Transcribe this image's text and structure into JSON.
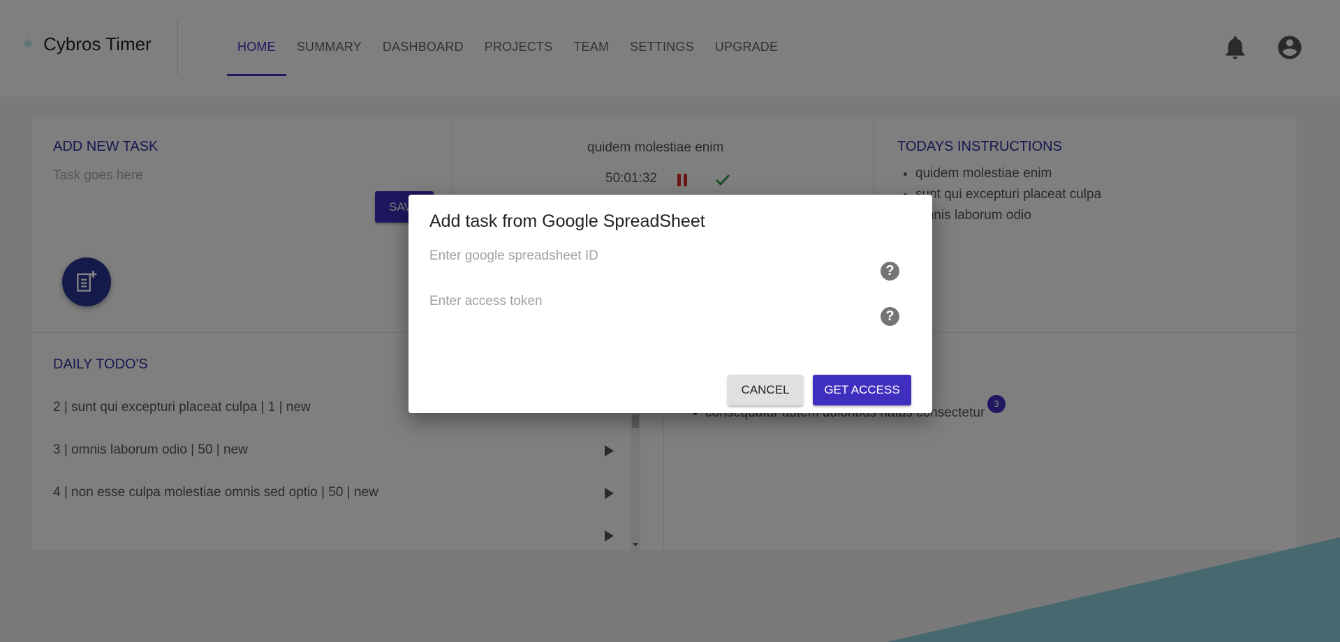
{
  "header": {
    "brand_icon": "react-atom-icon",
    "brand_name": "Cybros Timer",
    "nav": [
      "HOME",
      "SUMMARY",
      "DASHBOARD",
      "PROJECTS",
      "TEAM",
      "SETTINGS",
      "UPGRADE"
    ],
    "active_nav": "HOME",
    "icons": [
      "bell-icon",
      "account-circle-icon"
    ]
  },
  "add_task": {
    "title": "ADD NEW TASK",
    "placeholder": "Task goes here",
    "save_label": "SAVE",
    "fab_icon": "note-add-icon"
  },
  "timer": {
    "task_name": "quidem molestiae enim",
    "elapsed": "50:01:32",
    "pause_icon": "pause-icon",
    "complete_icon": "check-icon"
  },
  "instructions": {
    "title": "TODAYS INSTRUCTIONS",
    "items": [
      "quidem molestiae enim",
      "sunt qui excepturi placeat culpa",
      "omnis laborum odio"
    ]
  },
  "daily_todos": {
    "title": "DAILY TODO'S",
    "items": [
      "2 | sunt qui excepturi placeat culpa | 1 | new",
      "3 | omnis laborum odio | 50 | new",
      "4 | non esse culpa molestiae omnis sed optio | 50 | new"
    ]
  },
  "notes": {
    "item": "consequatur autem doloribus natus consectetur",
    "badge": "3"
  },
  "colors": {
    "primary": "#3f2fbf",
    "title_blue": "#2b2f9e",
    "fab": "#283593",
    "pause_red": "#d32f2f",
    "check_green": "#2e9e4f",
    "deco_teal": "#8fd0dc"
  },
  "modal": {
    "title": "Add task from Google SpreadSheet",
    "sheet_placeholder": "Enter google spreadsheet ID",
    "token_placeholder": "Enter access token",
    "cancel_label": "CANCEL",
    "access_label": "GET ACCESS"
  }
}
